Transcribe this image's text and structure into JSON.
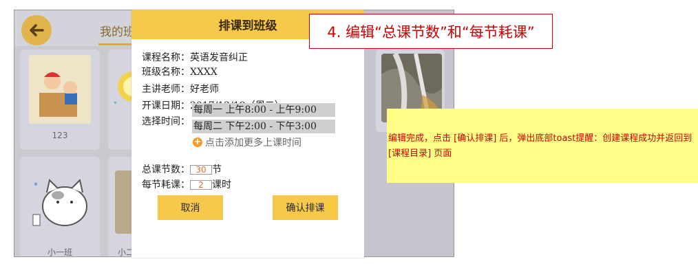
{
  "app": {
    "title": "我的班",
    "cards": [
      {
        "caption": "123"
      },
      {
        "caption": "小一班"
      },
      {
        "caption": "小二"
      }
    ]
  },
  "dialog": {
    "title": "排课到班级",
    "course_name_label": "课程名称：",
    "course_name": "英语发音纠正",
    "class_name_label": "班级名称：",
    "class_name": "XXXX",
    "teacher_label": "主讲老师：",
    "teacher": "好老师",
    "start_date_label": "开课日期：",
    "start_date": "2017/12/19（周二）",
    "select_time_label": "选择时间：",
    "time_slots": [
      "每周一 上午8:00 - 上午9:00",
      "每周二 下午2:00 - 下午3:00"
    ],
    "add_time_label": "点击添加更多上课时间",
    "total_lessons_label": "总课节数：",
    "total_lessons": "30",
    "total_lessons_unit": "节",
    "per_lesson_label": "每节耗课：",
    "per_lesson": "2",
    "per_lesson_unit": "课时",
    "cancel_label": "取消",
    "confirm_label": "确认排课"
  },
  "annotation": {
    "step": "4. 编辑“总课节数”和“每节耗课”",
    "note": "编辑完成，点击 [确认排课] 后，弹出底部toast提醒：创建课程成功并返回到 [课程目录] 页面"
  },
  "colors": {
    "accent": "#f6c94a",
    "annotation_red": "#cc0000",
    "note_bg": "#ffff88"
  }
}
